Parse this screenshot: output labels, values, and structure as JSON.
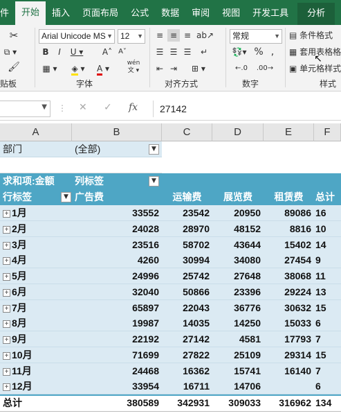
{
  "tabs": [
    "件",
    "开始",
    "插入",
    "页面布局",
    "公式",
    "数据",
    "审阅",
    "视图",
    "开发工具",
    "分析"
  ],
  "ribbon": {
    "groups": [
      "粘贴板",
      "字体",
      "对齐方式",
      "数字",
      "样式"
    ],
    "font_name": "Arial Unicode MS",
    "font_size": "12",
    "number_format": "常规",
    "styles": [
      "条件格式",
      "套用表格格式",
      "单元格样式"
    ],
    "wen_label": "wén"
  },
  "formula_bar": {
    "name_box": "",
    "cancel": "✕",
    "enter": "✓",
    "fx": "fx",
    "value": "27142"
  },
  "grid": {
    "columns": [
      "A",
      "B",
      "C",
      "D",
      "E",
      "F"
    ],
    "filter": {
      "label": "部门",
      "value": "(全部)"
    },
    "pivot_header": {
      "sum_label": "求和项:金额",
      "col_label": "列标签"
    },
    "row_label_header": "行标签",
    "categories": [
      "广告费",
      "运输费",
      "展览费",
      "租赁费",
      "总计"
    ],
    "rows": [
      {
        "label": "1月",
        "values": [
          "33552",
          "23542",
          "20950",
          "89086",
          "16"
        ]
      },
      {
        "label": "2月",
        "values": [
          "24028",
          "28970",
          "48152",
          "8816",
          "10"
        ]
      },
      {
        "label": "3月",
        "values": [
          "23516",
          "58702",
          "43644",
          "15402",
          "14"
        ]
      },
      {
        "label": "4月",
        "values": [
          "4260",
          "30994",
          "34080",
          "27454",
          "9"
        ]
      },
      {
        "label": "5月",
        "values": [
          "24996",
          "25742",
          "27648",
          "38068",
          "11"
        ]
      },
      {
        "label": "6月",
        "values": [
          "32040",
          "50866",
          "23396",
          "29224",
          "13"
        ]
      },
      {
        "label": "7月",
        "values": [
          "65897",
          "22043",
          "36776",
          "30632",
          "15"
        ]
      },
      {
        "label": "8月",
        "values": [
          "19987",
          "14035",
          "14250",
          "15033",
          "6"
        ]
      },
      {
        "label": "9月",
        "values": [
          "22192",
          "27142",
          "4581",
          "17793",
          "7"
        ]
      },
      {
        "label": "10月",
        "values": [
          "71699",
          "27822",
          "25109",
          "29314",
          "15"
        ]
      },
      {
        "label": "11月",
        "values": [
          "24468",
          "16362",
          "15741",
          "16140",
          "7"
        ]
      },
      {
        "label": "12月",
        "values": [
          "33954",
          "16711",
          "14706",
          "",
          "6"
        ]
      }
    ],
    "total": {
      "label": "总计",
      "values": [
        "380589",
        "342931",
        "309033",
        "316962",
        "134"
      ]
    }
  }
}
